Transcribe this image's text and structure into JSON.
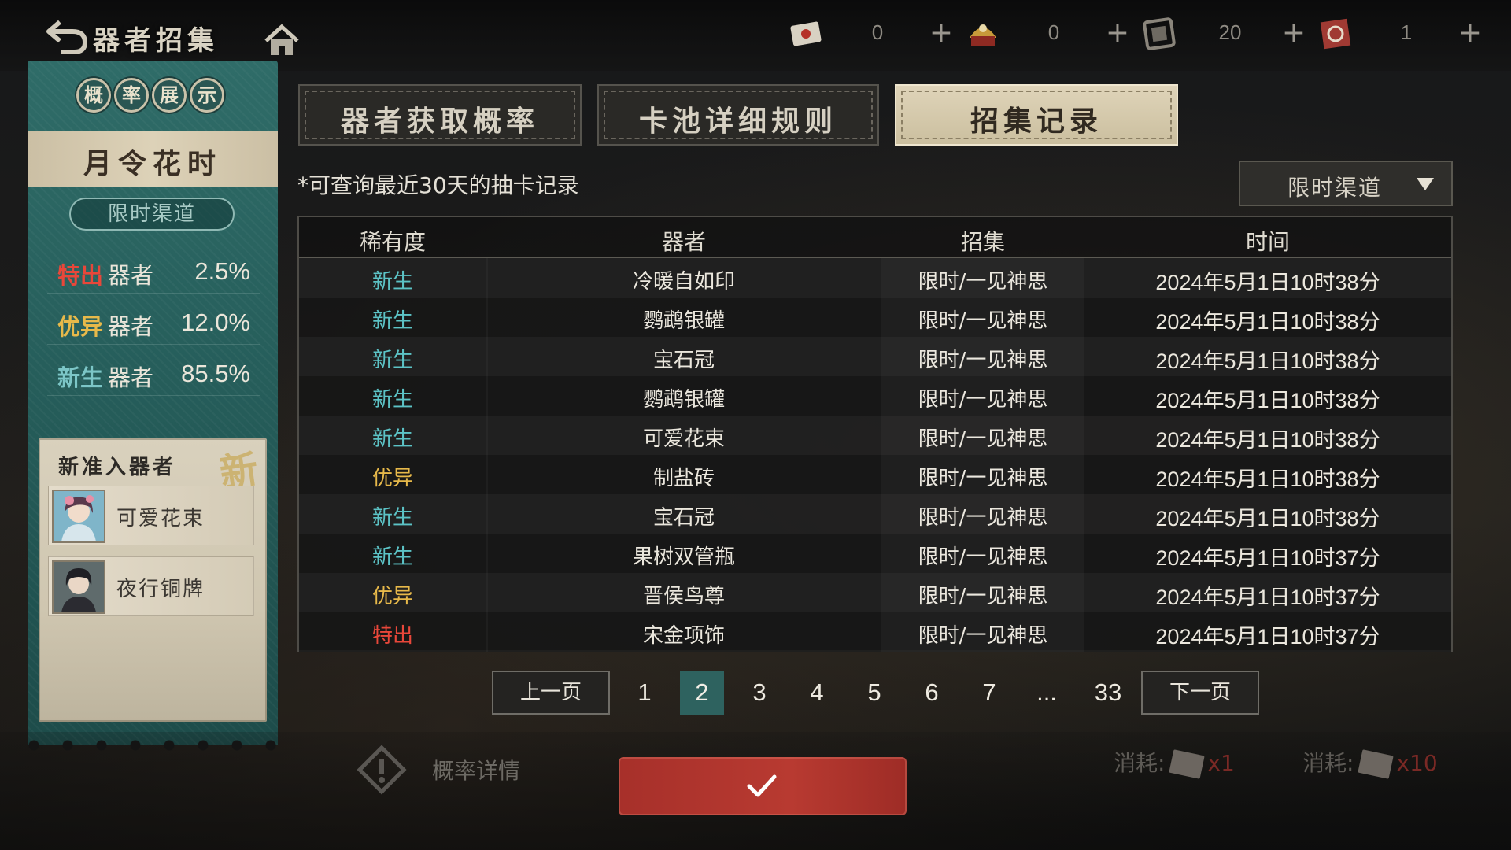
{
  "header": {
    "title": "器者招集",
    "currencies": [
      {
        "icon": "red-envelope-ticket-icon",
        "value": "0"
      },
      {
        "icon": "lantern-token-icon",
        "value": "0"
      },
      {
        "icon": "scroll-token-icon",
        "value": "20"
      },
      {
        "icon": "seal-token-icon",
        "value": "1"
      }
    ],
    "plus": "+"
  },
  "left_panel": {
    "badges": [
      "概",
      "率",
      "展",
      "示"
    ],
    "pool_name": "月令花时",
    "channel": "限时渠道",
    "rates": [
      {
        "rarity": "特出",
        "kind": "器者",
        "pct": "2.5%",
        "color": "#e8473a"
      },
      {
        "rarity": "优异",
        "kind": "器者",
        "pct": "12.0%",
        "color": "#e7b94a"
      },
      {
        "rarity": "新生",
        "kind": "器者",
        "pct": "85.5%",
        "color": "#7cc6c7"
      }
    ],
    "new_title": "新准入器者",
    "new_stamp": "新",
    "new_items": [
      {
        "name": "可爱花束",
        "icon": "character-portrait-icon"
      },
      {
        "name": "夜行铜牌",
        "icon": "character-portrait-icon"
      }
    ]
  },
  "tabs": [
    {
      "label": "器者获取概率",
      "active": false
    },
    {
      "label": "卡池详细规则",
      "active": false
    },
    {
      "label": "招集记录",
      "active": true
    }
  ],
  "note": "*可查询最近30天的抽卡记录",
  "dropdown": {
    "value": "限时渠道",
    "icon": "triangle-down-icon"
  },
  "colors": {
    "特出": "#e8473a",
    "优异": "#e7b94a",
    "新生": "#5cc3c6",
    "accent": "#2e625f",
    "confirm": "#b3372f"
  },
  "table": {
    "headers": [
      "稀有度",
      "器者",
      "招集",
      "时间"
    ],
    "rows": [
      {
        "rarity": "新生",
        "name": "冷暖自如印",
        "pool": "限时/一见神思",
        "time": "2024年5月1日10时38分"
      },
      {
        "rarity": "新生",
        "name": "鹦鹉银罐",
        "pool": "限时/一见神思",
        "time": "2024年5月1日10时38分"
      },
      {
        "rarity": "新生",
        "name": "宝石冠",
        "pool": "限时/一见神思",
        "time": "2024年5月1日10时38分"
      },
      {
        "rarity": "新生",
        "name": "鹦鹉银罐",
        "pool": "限时/一见神思",
        "time": "2024年5月1日10时38分"
      },
      {
        "rarity": "新生",
        "name": "可爱花束",
        "pool": "限时/一见神思",
        "time": "2024年5月1日10时38分"
      },
      {
        "rarity": "优异",
        "name": "制盐砖",
        "pool": "限时/一见神思",
        "time": "2024年5月1日10时38分"
      },
      {
        "rarity": "新生",
        "name": "宝石冠",
        "pool": "限时/一见神思",
        "time": "2024年5月1日10时38分"
      },
      {
        "rarity": "新生",
        "name": "果树双管瓶",
        "pool": "限时/一见神思",
        "time": "2024年5月1日10时37分"
      },
      {
        "rarity": "优异",
        "name": "晋侯鸟尊",
        "pool": "限时/一见神思",
        "time": "2024年5月1日10时37分"
      },
      {
        "rarity": "特出",
        "name": "宋金项饰",
        "pool": "限时/一见神思",
        "time": "2024年5月1日10时37分"
      }
    ]
  },
  "pagination": {
    "prev": "上一页",
    "next": "下一页",
    "pages": [
      "1",
      "2",
      "3",
      "4",
      "5",
      "6",
      "7",
      "...",
      "33"
    ],
    "current": "2"
  },
  "bottom": {
    "prob_detail": "概率详情",
    "cost_label": "消耗:",
    "cost_single": "x1",
    "cost_ten": "x10",
    "confirm_icon": "checkmark-icon"
  }
}
